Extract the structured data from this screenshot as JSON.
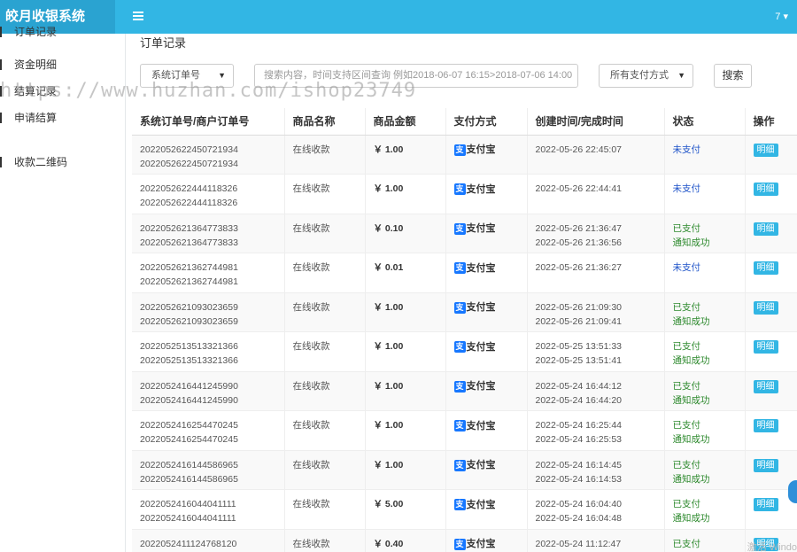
{
  "brand": "皎月收银系统",
  "user_menu": "7 ▾",
  "sidebar": {
    "items": [
      {
        "label": "订单记录"
      },
      {
        "label": "资金明细"
      },
      {
        "label": "结算记录"
      },
      {
        "label": "申请结算"
      },
      {
        "label": "收款二维码"
      }
    ]
  },
  "page_title": "订单记录",
  "filters": {
    "order_type": "系统订单号",
    "search_placeholder": "搜索内容，时间支持区间查询 例如2018-06-07 16:15>2018-07-06 14:00",
    "pay_method": "所有支付方式",
    "search_button": "搜索"
  },
  "table": {
    "headers": [
      "系统订单号/商户订单号",
      "商品名称",
      "商品金额",
      "支付方式",
      "创建时间/完成时间",
      "状态",
      "操作"
    ],
    "rows": [
      {
        "order": "2022052622450721934",
        "merchant": "2022052622450721934",
        "name": "在线收款",
        "amount": "￥ 1.00",
        "pay": "支付宝",
        "created": "2022-05-26 22:45:07",
        "done": "",
        "status": "未支付",
        "notify": "",
        "action": "明细"
      },
      {
        "order": "2022052622444118326",
        "merchant": "2022052622444118326",
        "name": "在线收款",
        "amount": "￥ 1.00",
        "pay": "支付宝",
        "created": "2022-05-26 22:44:41",
        "done": "",
        "status": "未支付",
        "notify": "",
        "action": "明细"
      },
      {
        "order": "2022052621364773833",
        "merchant": "2022052621364773833",
        "name": "在线收款",
        "amount": "￥ 0.10",
        "pay": "支付宝",
        "created": "2022-05-26 21:36:47",
        "done": "2022-05-26 21:36:56",
        "status": "已支付",
        "notify": "通知成功",
        "action": "明细"
      },
      {
        "order": "2022052621362744981",
        "merchant": "2022052621362744981",
        "name": "在线收款",
        "amount": "￥ 0.01",
        "pay": "支付宝",
        "created": "2022-05-26 21:36:27",
        "done": "",
        "status": "未支付",
        "notify": "",
        "action": "明细"
      },
      {
        "order": "2022052621093023659",
        "merchant": "2022052621093023659",
        "name": "在线收款",
        "amount": "￥ 1.00",
        "pay": "支付宝",
        "created": "2022-05-26 21:09:30",
        "done": "2022-05-26 21:09:41",
        "status": "已支付",
        "notify": "通知成功",
        "action": "明细"
      },
      {
        "order": "2022052513513321366",
        "merchant": "2022052513513321366",
        "name": "在线收款",
        "amount": "￥ 1.00",
        "pay": "支付宝",
        "created": "2022-05-25 13:51:33",
        "done": "2022-05-25 13:51:41",
        "status": "已支付",
        "notify": "通知成功",
        "action": "明细"
      },
      {
        "order": "2022052416441245990",
        "merchant": "2022052416441245990",
        "name": "在线收款",
        "amount": "￥ 1.00",
        "pay": "支付宝",
        "created": "2022-05-24 16:44:12",
        "done": "2022-05-24 16:44:20",
        "status": "已支付",
        "notify": "通知成功",
        "action": "明细"
      },
      {
        "order": "2022052416254470245",
        "merchant": "2022052416254470245",
        "name": "在线收款",
        "amount": "￥ 1.00",
        "pay": "支付宝",
        "created": "2022-05-24 16:25:44",
        "done": "2022-05-24 16:25:53",
        "status": "已支付",
        "notify": "通知成功",
        "action": "明细"
      },
      {
        "order": "2022052416144586965",
        "merchant": "2022052416144586965",
        "name": "在线收款",
        "amount": "￥ 1.00",
        "pay": "支付宝",
        "created": "2022-05-24 16:14:45",
        "done": "2022-05-24 16:14:53",
        "status": "已支付",
        "notify": "通知成功",
        "action": "明细"
      },
      {
        "order": "2022052416044041111",
        "merchant": "2022052416044041111",
        "name": "在线收款",
        "amount": "￥ 5.00",
        "pay": "支付宝",
        "created": "2022-05-24 16:04:40",
        "done": "2022-05-24 16:04:48",
        "status": "已支付",
        "notify": "通知成功",
        "action": "明细"
      },
      {
        "order": "2022052411124768120",
        "merchant": "",
        "name": "在线收款",
        "amount": "￥ 0.40",
        "pay": "支付宝",
        "created": "2022-05-24 11:12:47",
        "done": "",
        "status": "已支付",
        "notify": "",
        "action": "明细"
      }
    ]
  },
  "watermark": "https://www.huzhan.com/ishop23749",
  "corner_text": "激活 Windo",
  "colors": {
    "topbar": "#32b6e4",
    "brand_bg": "#2aa3d1",
    "unpaid": "#1d52c8",
    "paid": "#2e8a2e",
    "alipay": "#1677ff"
  },
  "icons": {
    "menu_toggle": "list-icon",
    "pay_method": "alipay-icon",
    "dropdown": "caret-down-icon"
  }
}
